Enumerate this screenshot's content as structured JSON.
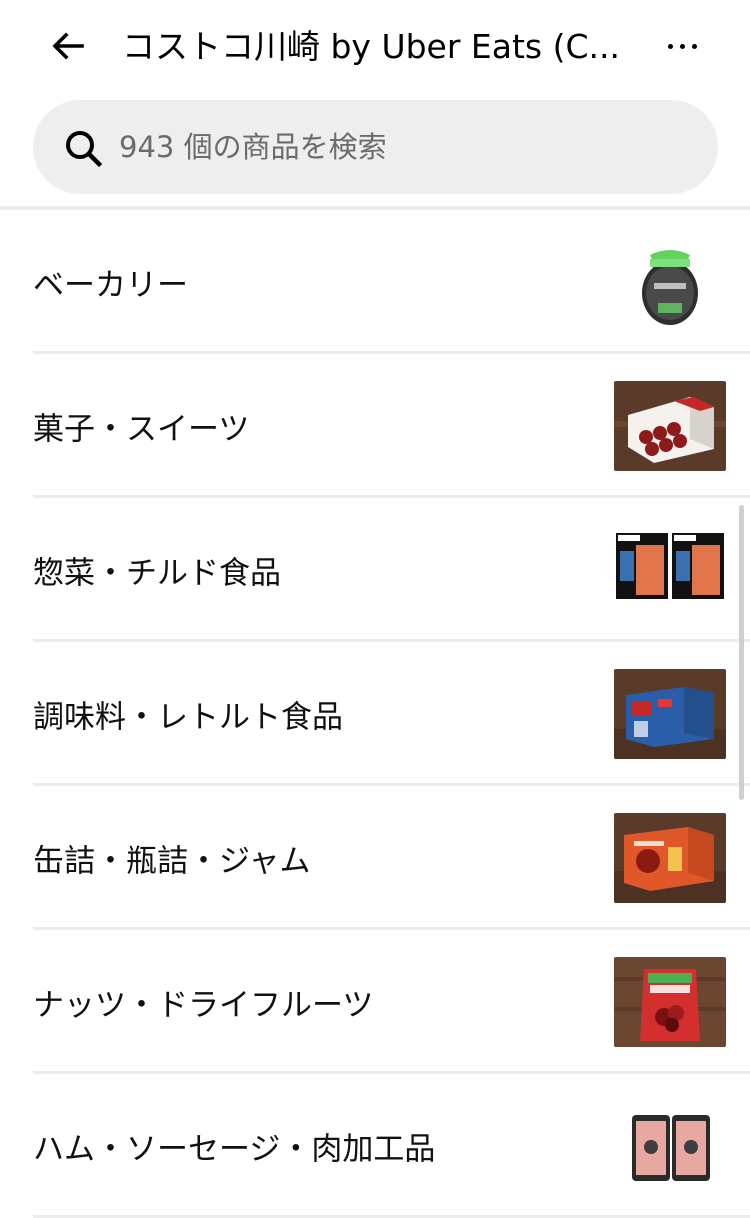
{
  "header": {
    "title": "コストコ川崎 by Uber Eats (C...",
    "back_icon": "arrow-left-icon",
    "more_icon": "more-horizontal-icon"
  },
  "search": {
    "placeholder": "943 個の商品を検索",
    "icon": "search-icon"
  },
  "categories": [
    {
      "label": "ベーカリー",
      "thumb": "bakery-product-image"
    },
    {
      "label": "菓子・スイーツ",
      "thumb": "sweets-box-image"
    },
    {
      "label": "惣菜・チルド食品",
      "thumb": "chilled-salmon-image"
    },
    {
      "label": "調味料・レトルト食品",
      "thumb": "retort-box-image"
    },
    {
      "label": "缶詰・瓶詰・ジャム",
      "thumb": "canned-goods-image"
    },
    {
      "label": "ナッツ・ドライフルーツ",
      "thumb": "dried-fruit-bag-image"
    },
    {
      "label": "ハム・ソーセージ・肉加工品",
      "thumb": "ham-pack-image"
    }
  ],
  "colors": {
    "search_bg": "#eeeeee",
    "divider": "#ececec",
    "text": "#111111"
  }
}
